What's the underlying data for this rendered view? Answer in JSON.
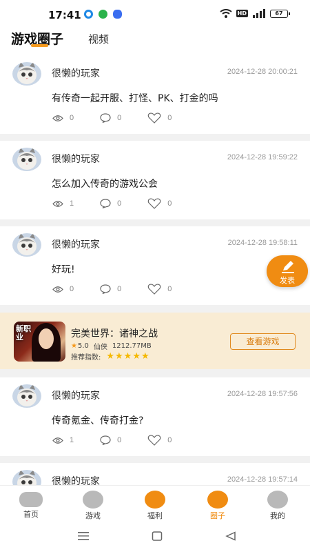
{
  "status_bar": {
    "time": "17:41",
    "hd": "HD",
    "battery": "67",
    "app_icon_colors": [
      "#1e88e5",
      "#2bb34b",
      "#3a6df0"
    ]
  },
  "header": {
    "tab_active": "游戏圈子",
    "tab_inactive": "视频",
    "accent_color": "#f59a1e"
  },
  "posts": [
    {
      "username": "很懒的玩家",
      "time": "2024-12-28 20:00:21",
      "text": "有传奇一起开服、打怪、PK、打金的吗",
      "views": "0",
      "comments": "0",
      "likes": "0"
    },
    {
      "username": "很懒的玩家",
      "time": "2024-12-28 19:59:22",
      "text": "怎么加入传奇的游戏公会",
      "views": "1",
      "comments": "0",
      "likes": "0"
    },
    {
      "username": "很懒的玩家",
      "time": "2024-12-28 19:58:11",
      "text": "好玩!",
      "views": "0",
      "comments": "0",
      "likes": "0"
    },
    {
      "username": "很懒的玩家",
      "time": "2024-12-28 19:57:56",
      "text": "传奇氪金、传奇打金?",
      "views": "1",
      "comments": "0",
      "likes": "0"
    },
    {
      "username": "很懒的玩家",
      "time": "2024-12-28 19:57:14",
      "text": "",
      "views": "",
      "comments": "",
      "likes": ""
    }
  ],
  "ad": {
    "badge": "新职业",
    "name": "完美世界：诸神之战",
    "rating": "5.0",
    "genre": "仙侠",
    "size": "1212.77MB",
    "recommend_label": "推荐指数:",
    "stars": "★★★★★",
    "button_label": "查看游戏"
  },
  "fab": {
    "label": "发表"
  },
  "bottom_nav": [
    {
      "label": "首页",
      "icon": "gamepad-icon",
      "active": false
    },
    {
      "label": "游戏",
      "icon": "heart-bubble-icon",
      "active": false
    },
    {
      "label": "福利",
      "icon": "gift-icon",
      "active": false
    },
    {
      "label": "圈子",
      "icon": "circle-chat-icon",
      "active": true
    },
    {
      "label": "我的",
      "icon": "sunglasses-face-icon",
      "active": false
    }
  ]
}
